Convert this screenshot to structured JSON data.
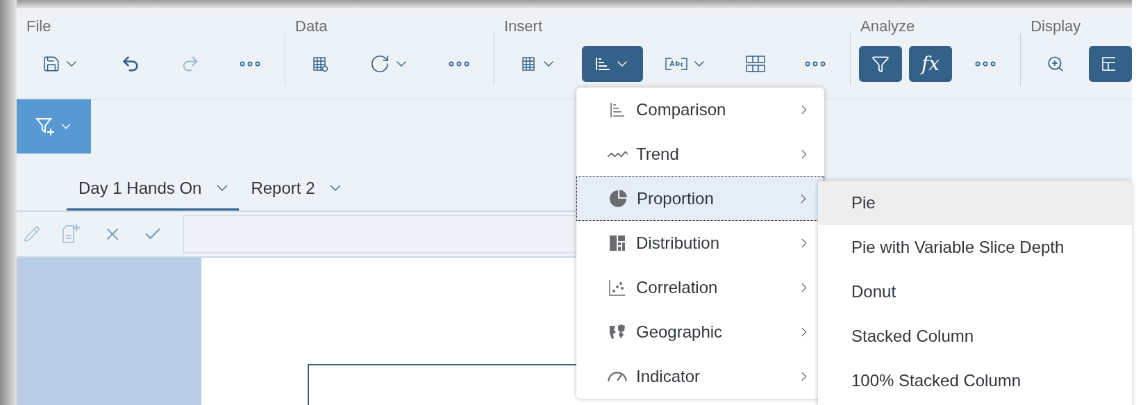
{
  "toolbar": {
    "groups": [
      {
        "label": "File",
        "items": [
          {
            "kind": "save",
            "dropdown": true,
            "active": false,
            "disabled": false
          },
          {
            "kind": "undo",
            "dropdown": false,
            "active": false,
            "disabled": false
          },
          {
            "kind": "redo",
            "dropdown": false,
            "active": false,
            "disabled": true
          },
          {
            "kind": "more",
            "dropdown": false,
            "active": false,
            "disabled": false
          }
        ]
      },
      {
        "label": "Data",
        "items": [
          {
            "kind": "table-settings",
            "dropdown": false,
            "active": false,
            "disabled": false
          },
          {
            "kind": "refresh",
            "dropdown": true,
            "active": false,
            "disabled": false
          },
          {
            "kind": "more",
            "dropdown": false,
            "active": false,
            "disabled": false
          }
        ]
      },
      {
        "label": "Insert",
        "items": [
          {
            "kind": "table",
            "dropdown": true,
            "active": false,
            "disabled": false
          },
          {
            "kind": "chart",
            "dropdown": true,
            "active": true,
            "disabled": false
          },
          {
            "kind": "text",
            "dropdown": true,
            "active": false,
            "disabled": false
          },
          {
            "kind": "grid",
            "dropdown": false,
            "active": false,
            "disabled": false
          },
          {
            "kind": "more",
            "dropdown": false,
            "active": false,
            "disabled": false
          }
        ]
      },
      {
        "label": "Analyze",
        "items": [
          {
            "kind": "filter",
            "dropdown": false,
            "active": true,
            "disabled": false
          },
          {
            "kind": "formula",
            "label": "fx",
            "dropdown": false,
            "active": true,
            "disabled": false
          },
          {
            "kind": "more",
            "dropdown": false,
            "active": false,
            "disabled": false
          }
        ]
      },
      {
        "label": "Display",
        "items": [
          {
            "kind": "zoom",
            "dropdown": false,
            "active": false,
            "disabled": false
          },
          {
            "kind": "layout",
            "dropdown": false,
            "active": true,
            "disabled": false
          }
        ]
      }
    ]
  },
  "tabs": [
    {
      "label": "Day 1 Hands On",
      "selected": true
    },
    {
      "label": "Report 2",
      "selected": false
    }
  ],
  "chart_menu": {
    "items": [
      {
        "label": "Comparison",
        "kind": "comparison",
        "selected": false
      },
      {
        "label": "Trend",
        "kind": "trend",
        "selected": false
      },
      {
        "label": "Proportion",
        "kind": "proportion",
        "selected": true
      },
      {
        "label": "Distribution",
        "kind": "distribution",
        "selected": false
      },
      {
        "label": "Correlation",
        "kind": "correlation",
        "selected": false
      },
      {
        "label": "Geographic",
        "kind": "geographic",
        "selected": false
      },
      {
        "label": "Indicator",
        "kind": "indicator",
        "selected": false
      }
    ]
  },
  "submenu": {
    "items": [
      {
        "label": "Pie",
        "selected": true
      },
      {
        "label": "Pie with Variable Slice Depth",
        "selected": false
      },
      {
        "label": "Donut",
        "selected": false
      },
      {
        "label": "Stacked Column",
        "selected": false
      },
      {
        "label": "100% Stacked Column",
        "selected": false
      }
    ]
  }
}
